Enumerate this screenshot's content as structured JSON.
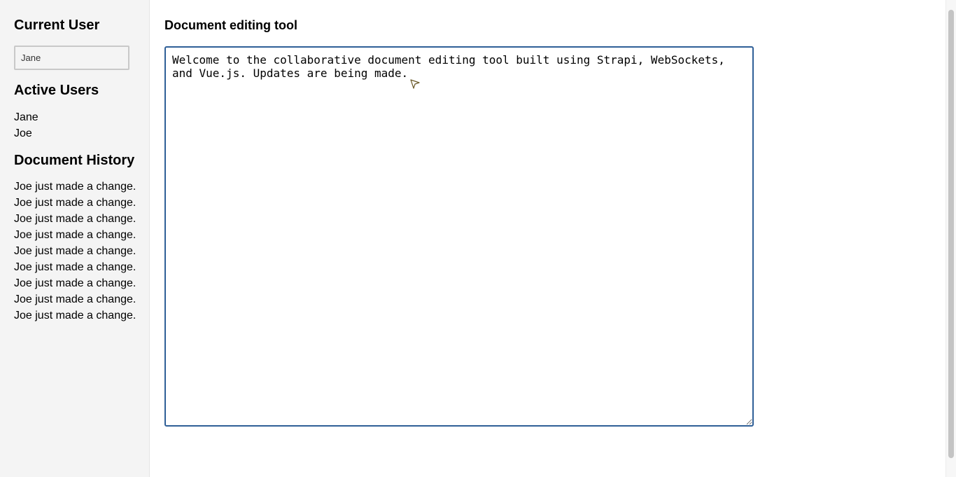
{
  "sidebar": {
    "current_user_heading": "Current User",
    "current_user_value": "Jane",
    "active_users_heading": "Active Users",
    "active_users": [
      "Jane",
      "Joe"
    ],
    "history_heading": "Document History",
    "history": [
      "Joe just made a change.",
      "Joe just made a change.",
      "Joe just made a change.",
      "Joe just made a change.",
      "Joe just made a change.",
      "Joe just made a change.",
      "Joe just made a change.",
      "Joe just made a change.",
      "Joe just made a change."
    ]
  },
  "main": {
    "title": "Document editing tool",
    "document_text": "Welcome to the collaborative document editing tool built using Strapi, WebSockets, and Vue.js. Updates are being made."
  },
  "icons": {
    "cursor": "mouse-pointer-icon"
  },
  "colors": {
    "sidebar_bg": "#f4f4f4",
    "editor_border": "#2f5f97"
  }
}
